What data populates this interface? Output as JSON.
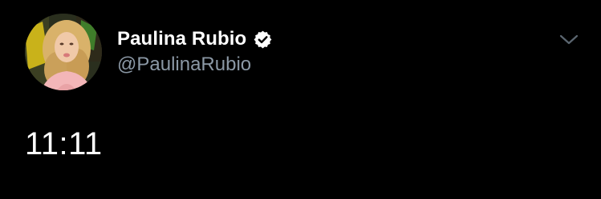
{
  "tweet": {
    "author": {
      "display_name": "Paulina Rubio",
      "handle": "@PaulinaRubio",
      "verified": true,
      "avatar_icon": "profile-photo"
    },
    "text": "11:11",
    "menu_icon": "chevron-down-icon"
  },
  "colors": {
    "background": "#000000",
    "name": "#ffffff",
    "handle": "#8b98a5",
    "verified_badge": "#ffffff",
    "caret": "#5b6670"
  }
}
